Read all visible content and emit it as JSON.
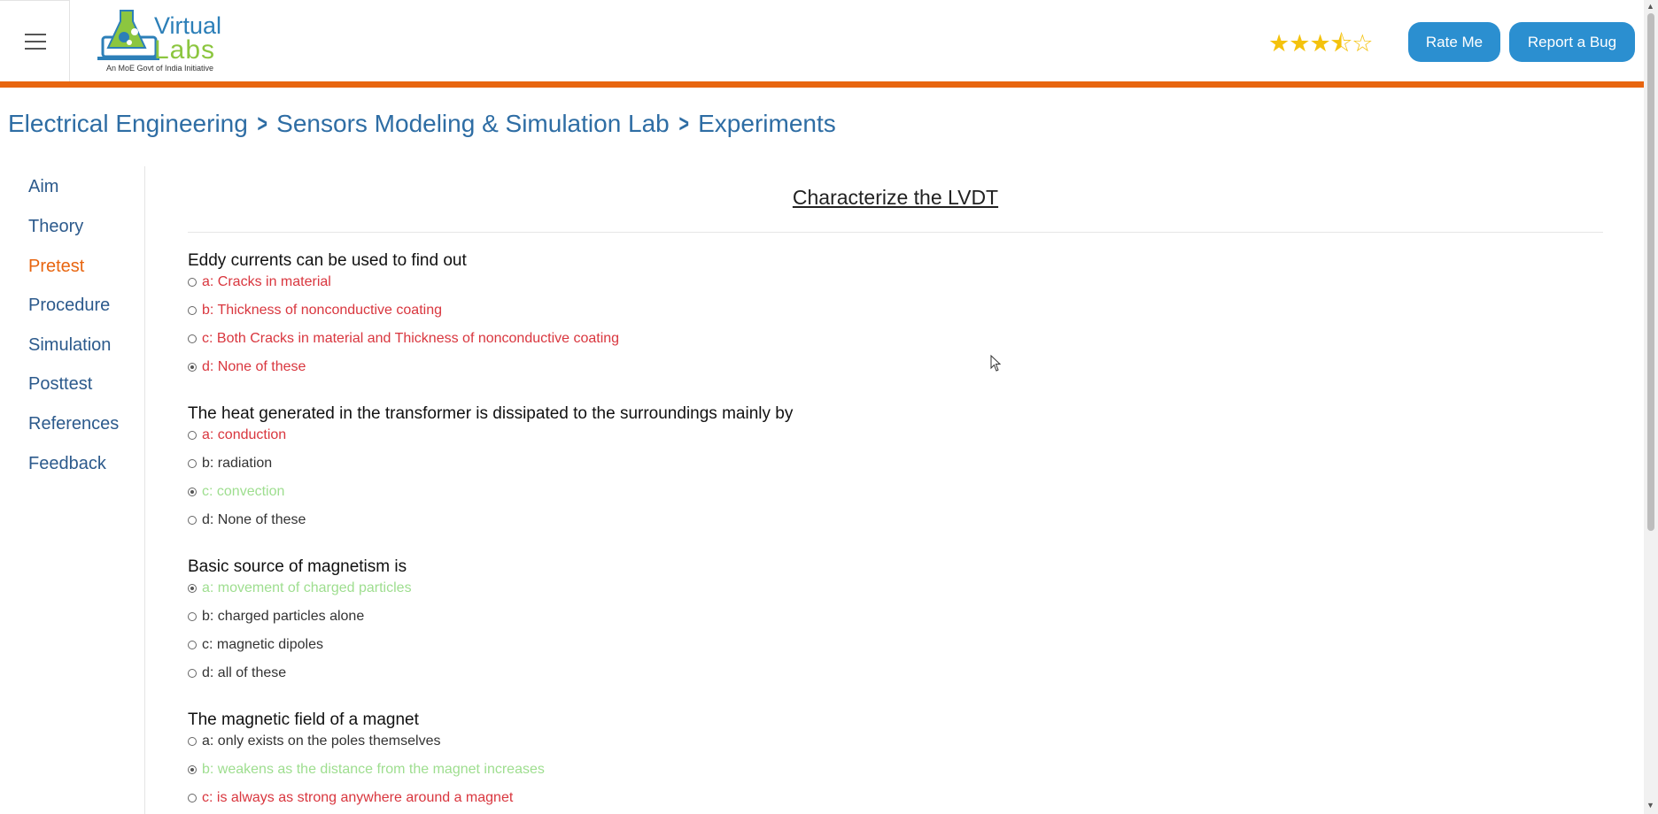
{
  "header": {
    "logo": {
      "line1": "Virtual",
      "line2": "Labs",
      "tagline": "An MoE Govt of India Initiative"
    },
    "rating_stars": [
      "full",
      "full",
      "full",
      "half",
      "empty"
    ],
    "rate_label": "Rate Me",
    "bug_label": "Report a Bug",
    "accent_color": "#e8650f",
    "button_color": "#2b8fd0"
  },
  "breadcrumb": [
    "Electrical Engineering",
    "Sensors Modeling & Simulation Lab",
    "Experiments"
  ],
  "sidebar": {
    "items": [
      {
        "label": "Aim",
        "active": false
      },
      {
        "label": "Theory",
        "active": false
      },
      {
        "label": "Pretest",
        "active": true
      },
      {
        "label": "Procedure",
        "active": false
      },
      {
        "label": "Simulation",
        "active": false
      },
      {
        "label": "Posttest",
        "active": false
      },
      {
        "label": "References",
        "active": false
      },
      {
        "label": "Feedback",
        "active": false
      }
    ]
  },
  "main": {
    "title": "Characterize the LVDT",
    "questions": [
      {
        "text": "Eddy currents can be used to find out",
        "options": [
          {
            "label": "a: Cracks in material",
            "checked": false,
            "state": "incorrect"
          },
          {
            "label": "b: Thickness of nonconductive coating",
            "checked": false,
            "state": "incorrect"
          },
          {
            "label": "c: Both Cracks in material and Thickness of nonconductive coating",
            "checked": false,
            "state": "incorrect"
          },
          {
            "label": "d: None of these",
            "checked": true,
            "state": "incorrect"
          }
        ]
      },
      {
        "text": "The heat generated in the transformer is dissipated to the surroundings mainly by",
        "options": [
          {
            "label": "a: conduction",
            "checked": false,
            "state": "incorrect"
          },
          {
            "label": "b: radiation",
            "checked": false,
            "state": "normal"
          },
          {
            "label": "c: convection",
            "checked": true,
            "state": "correct"
          },
          {
            "label": "d: None of these",
            "checked": false,
            "state": "normal"
          }
        ]
      },
      {
        "text": "Basic source of magnetism is",
        "options": [
          {
            "label": "a: movement of charged particles",
            "checked": true,
            "state": "correct"
          },
          {
            "label": "b: charged particles alone",
            "checked": false,
            "state": "normal"
          },
          {
            "label": "c: magnetic dipoles",
            "checked": false,
            "state": "normal"
          },
          {
            "label": "d: all of these",
            "checked": false,
            "state": "normal"
          }
        ]
      },
      {
        "text": "The magnetic field of a magnet",
        "options": [
          {
            "label": "a: only exists on the poles themselves",
            "checked": false,
            "state": "normal"
          },
          {
            "label": "b: weakens as the distance from the magnet increases",
            "checked": true,
            "state": "correct"
          },
          {
            "label": "c: is always as strong anywhere around a magnet",
            "checked": false,
            "state": "incorrect"
          }
        ]
      }
    ],
    "colors": {
      "correct": "#9ede8f",
      "incorrect": "#d9363e",
      "normal": "#333333"
    }
  }
}
